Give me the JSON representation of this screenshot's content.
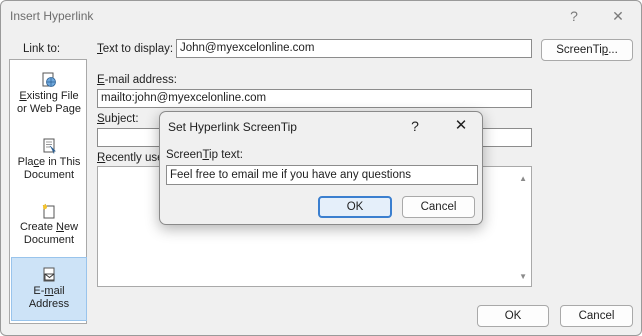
{
  "dialog": {
    "title": "Insert Hyperlink",
    "help_glyph": "?",
    "close_glyph": "✕",
    "link_to_label": "Link to:",
    "text_to_display_pre": "",
    "text_to_display_acc": "T",
    "text_to_display_post": "ext to display:",
    "text_to_display_value": "John@myexcelonline.com",
    "screentip_pre": "ScreenTi",
    "screentip_acc": "p",
    "screentip_post": "...",
    "email_label_pre": "",
    "email_label_acc": "E",
    "email_label_post": "-mail address:",
    "email_value": "mailto:john@myexcelonline.com",
    "subject_label_pre": "",
    "subject_label_acc": "S",
    "subject_label_post": "ubject:",
    "subject_value": "",
    "recent_label_pre": "",
    "recent_label_acc": "R",
    "recent_label_post": "ecently used e-mail addresses:",
    "ok_label": "OK",
    "cancel_label": "Cancel",
    "icons": {
      "existing": "web-page-globe-icon",
      "place": "document-place-icon",
      "new": "new-document-icon",
      "email": "email-envelope-icon"
    },
    "sidebar": [
      {
        "line1_pre": "",
        "line1_acc": "E",
        "line1_post": "xisting File",
        "line2": "or Web Page"
      },
      {
        "line1_pre": "Pla",
        "line1_acc": "c",
        "line1_post": "e in This",
        "line2": "Document"
      },
      {
        "line1_pre": "Create ",
        "line1_acc": "N",
        "line1_post": "ew",
        "line2": "Document"
      },
      {
        "line1_pre": "E-",
        "line1_acc": "m",
        "line1_post": "ail",
        "line2": "Address"
      }
    ],
    "selected_item": "E-mail Address"
  },
  "screentip_dialog": {
    "title": "Set Hyperlink ScreenTip",
    "help_glyph": "?",
    "close_glyph": "✕",
    "label_pre": "Screen",
    "label_acc": "T",
    "label_post": "ip text:",
    "value": "Feel free to email me if you have any questions",
    "ok_label": "OK",
    "cancel_label": "Cancel"
  },
  "colors": {
    "accent": "#3b7fcf",
    "selected_bg": "#cde3f7"
  }
}
